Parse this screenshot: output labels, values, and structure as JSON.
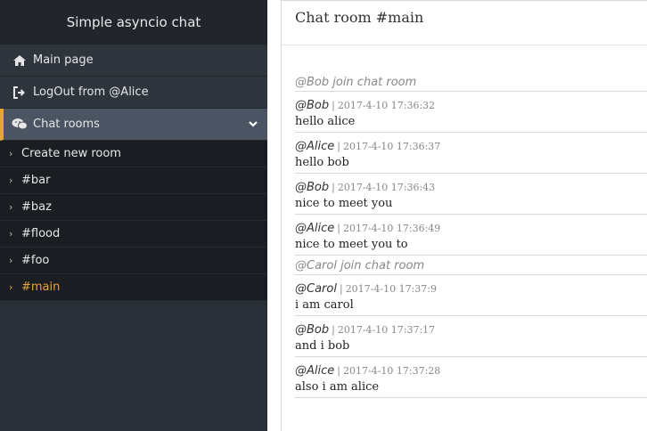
{
  "app_title": "Simple asyncio chat",
  "nav": {
    "main_page": "Main page",
    "logout": "LogOut from @Alice",
    "chat_rooms": "Chat rooms"
  },
  "rooms_menu": {
    "create": "Create new room",
    "rooms": [
      "#bar",
      "#baz",
      "#flood",
      "#foo",
      "#main"
    ],
    "current_room": "#main"
  },
  "room": {
    "title": "Chat room #main",
    "separator": "|",
    "messages": [
      {
        "type": "join",
        "text": "@Bob join chat room"
      },
      {
        "type": "chat",
        "user": "@Bob",
        "time": "2017-4-10 17:36:32",
        "text": "hello alice"
      },
      {
        "type": "chat",
        "user": "@Alice",
        "time": "2017-4-10 17:36:37",
        "text": "hello bob"
      },
      {
        "type": "chat",
        "user": "@Bob",
        "time": "2017-4-10 17:36:43",
        "text": "nice to meet you"
      },
      {
        "type": "chat",
        "user": "@Alice",
        "time": "2017-4-10 17:36:49",
        "text": "nice to meet you to"
      },
      {
        "type": "join",
        "text": "@Carol join chat room"
      },
      {
        "type": "chat",
        "user": "@Carol",
        "time": "2017-4-10 17:37:9",
        "text": "i am carol"
      },
      {
        "type": "chat",
        "user": "@Bob",
        "time": "2017-4-10 17:37:17",
        "text": "and i bob"
      },
      {
        "type": "chat",
        "user": "@Alice",
        "time": "2017-4-10 17:37:28",
        "text": "also i am alice"
      }
    ]
  },
  "colors": {
    "accent": "#e8a33a",
    "sidebar_bg": "#2a3038",
    "submenu_bg": "#1a1d21"
  }
}
